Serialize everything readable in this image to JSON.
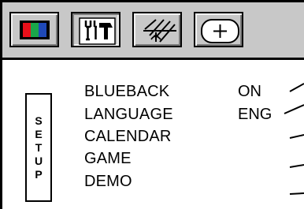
{
  "tabs": [
    {
      "icon": "color-bars-icon",
      "selected": true
    },
    {
      "icon": "tools-icon",
      "selected": false
    },
    {
      "icon": "antenna-icon",
      "selected": false
    },
    {
      "icon": "geometry-icon",
      "selected": false
    }
  ],
  "setup_label": "SETUP",
  "menu": [
    {
      "label": "BLUEBACK",
      "value": "ON"
    },
    {
      "label": "LANGUAGE",
      "value": "ENG"
    },
    {
      "label": "CALENDAR",
      "value": ""
    },
    {
      "label": "GAME",
      "value": ""
    },
    {
      "label": "DEMO",
      "value": ""
    }
  ],
  "colors": {
    "red": "#e8101a",
    "green": "#1aa64a",
    "blue": "#1f49b8",
    "panel": "#c8c8c8"
  }
}
